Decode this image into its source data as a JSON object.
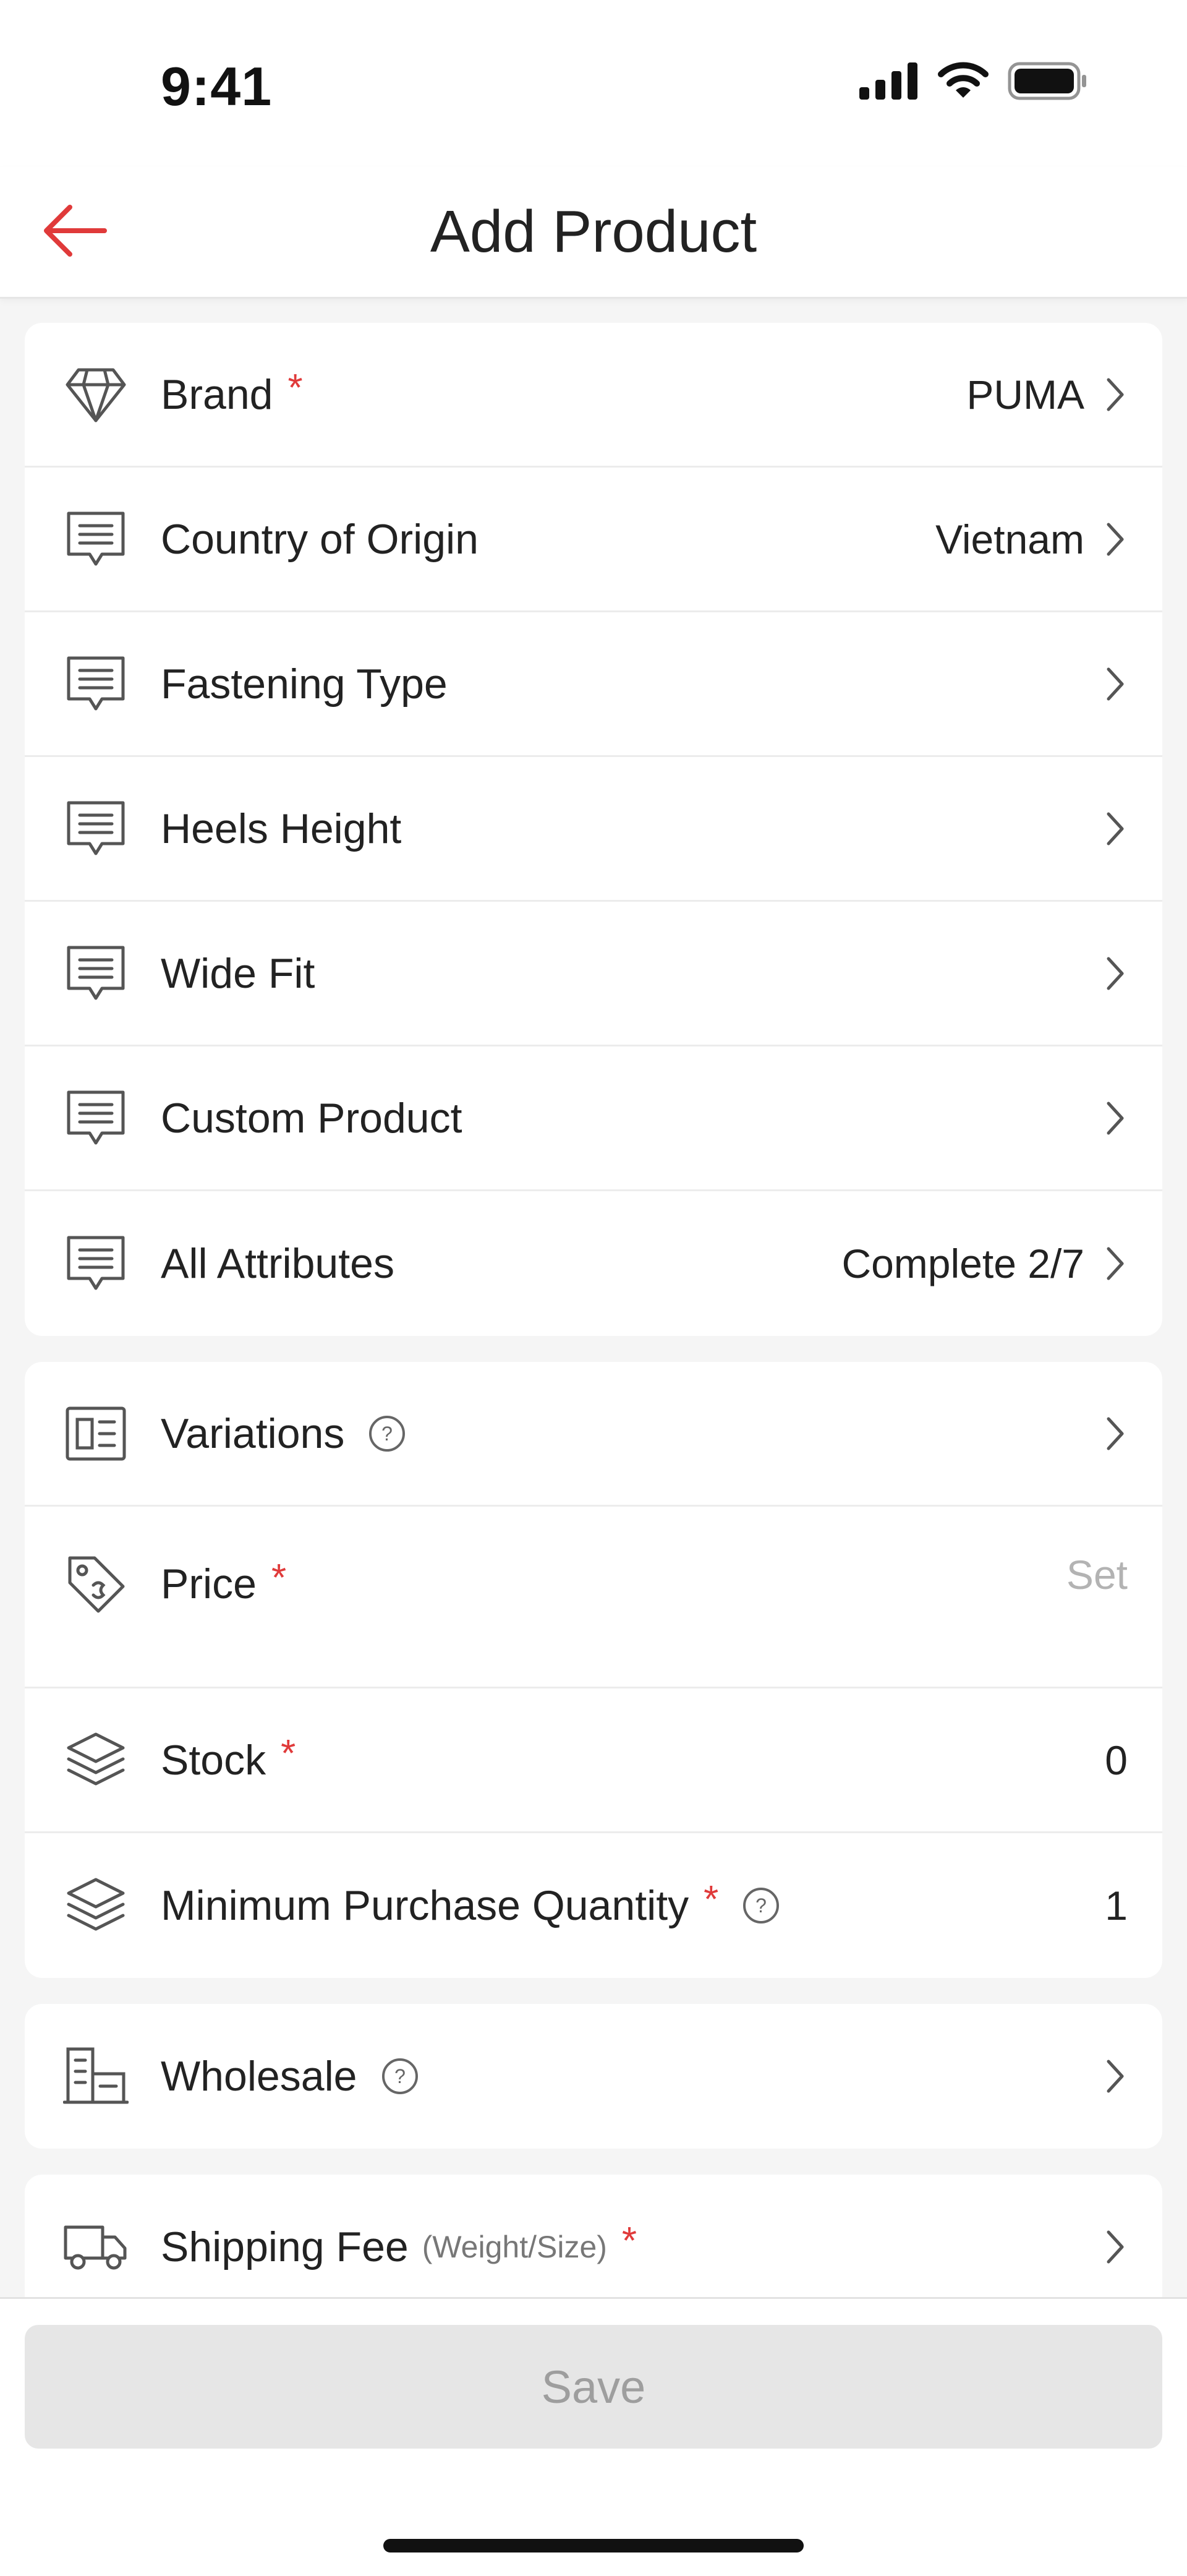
{
  "status_bar": {
    "time": "9:41"
  },
  "nav": {
    "title": "Add Product",
    "back_icon": "arrow-left-icon",
    "accent_color": "#e03a3a"
  },
  "sections": [
    {
      "rows": [
        {
          "label": "Brand",
          "required": "*",
          "value": "PUMA",
          "icon": "diamond-icon"
        },
        {
          "label": "Country of Origin",
          "value": "Vietnam",
          "icon": "message-lines-icon"
        },
        {
          "label": "Fastening Type",
          "value": "",
          "icon": "message-lines-icon"
        },
        {
          "label": "Heels Height",
          "value": "",
          "icon": "message-lines-icon"
        },
        {
          "label": "Wide Fit",
          "value": "",
          "icon": "message-lines-icon"
        },
        {
          "label": "Custom Product",
          "value": "",
          "icon": "message-lines-icon"
        },
        {
          "label": "All Attributes",
          "value": "Complete 2/7",
          "icon": "message-lines-icon"
        }
      ]
    },
    {
      "rows": [
        {
          "label": "Variations",
          "help": "?",
          "icon": "variations-icon"
        },
        {
          "label": "Price",
          "required": "*",
          "value": "Set",
          "icon": "price-tag-icon"
        },
        {
          "label": "Stock",
          "required": "*",
          "value": "0",
          "icon": "layers-icon"
        },
        {
          "label": "Minimum Purchase Quantity",
          "required": "*",
          "help": "?",
          "value": "1",
          "icon": "layers-icon"
        }
      ]
    },
    {
      "rows": [
        {
          "label": "Wholesale",
          "help": "?",
          "icon": "wholesale-icon"
        }
      ]
    },
    {
      "rows": [
        {
          "label": "Shipping Fee",
          "sublabel": "(Weight/Size)",
          "required": "*",
          "icon": "truck-icon"
        }
      ]
    }
  ],
  "footer": {
    "save_label": "Save"
  }
}
